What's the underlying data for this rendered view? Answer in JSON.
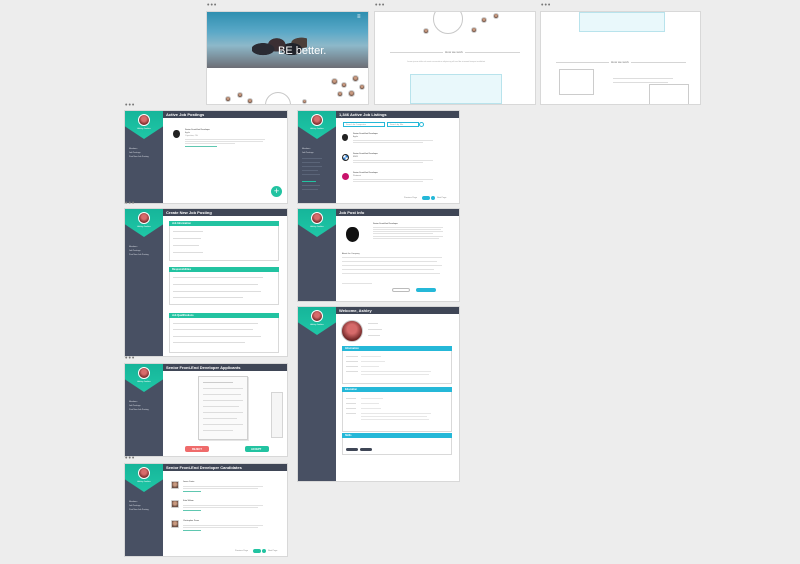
{
  "landing": {
    "hero_text": "BE better.",
    "menu_glyph": "≡",
    "section1_title": "How we work",
    "section1_body": "Lorem ipsum dolor sit amet consectetur adipiscing elit sed do eiusmod tempor incididunt",
    "section2_title": "How we work"
  },
  "sidebar": {
    "user_name": "Ashley Jenkins",
    "nav_1": "Members",
    "nav_2": "Job Postings",
    "nav_3": "Post New Job Posting"
  },
  "screens": {
    "active_postings": {
      "title": "Active Job Postings",
      "job_title": "Senior Front-End Developer",
      "company": "Apple",
      "location": "Cupertino, CA"
    },
    "listings": {
      "title": "1,346 Active Job Listings",
      "search_placeholder": "Search for Companies",
      "filter_placeholder": "Search by Title",
      "job_1": "Senior Front-End Developer",
      "job_2": "Senior Front-End Developer",
      "job_3": "Senior Front-End Developer",
      "company_1": "Apple",
      "company_2": "BMW",
      "company_3": "Pinterest",
      "prev": "Previous Page",
      "next": "Next Page"
    },
    "create": {
      "title": "Create New Job Posting",
      "section_1": "Job Information",
      "section_2": "Responsibilities",
      "section_3": "Job Qualifications"
    },
    "post_info": {
      "title": "Job Post Info",
      "job_title": "Senior Front-End Developer",
      "section": "About the Company"
    },
    "applicants": {
      "title": "Senior Front-End Developer Applicants",
      "reject": "REJECT",
      "accept": "ACCEPT"
    },
    "welcome": {
      "title": "Welcome, Ashley",
      "section_1": "Information",
      "section_2": "Education",
      "section_3": "Skills"
    },
    "candidates": {
      "title": "Senior Front-End Developer Candidates",
      "cand_1": "Jason Carter",
      "cand_2": "Kate Wilson",
      "cand_3": "Christopher Perez",
      "prev": "Previous Page",
      "next": "Next Page"
    }
  },
  "colors": {
    "teal": "#1fc7a6",
    "cyan": "#25b8d8",
    "sidebar": "#485063",
    "topbar": "#3f4656",
    "red": "#ef6b6b"
  }
}
